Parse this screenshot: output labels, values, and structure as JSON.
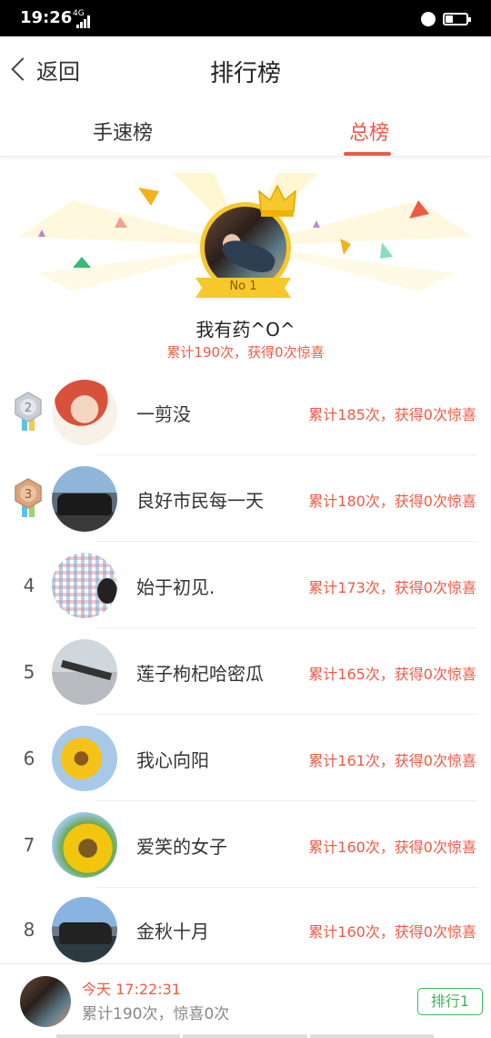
{
  "status_bar": {
    "time": "19:26",
    "network": "4G"
  },
  "header": {
    "back_label": "返回",
    "title": "排行榜"
  },
  "tabs": [
    {
      "label": "手速榜",
      "active": false
    },
    {
      "label": "总榜",
      "active": true
    }
  ],
  "champion": {
    "badge": "No 1",
    "name": "我有药^O^",
    "stats": "累计190次，获得0次惊喜"
  },
  "rankings": [
    {
      "rank": "2",
      "medal": "silver",
      "name": "一剪没",
      "stats": "累计185次，获得0次惊喜"
    },
    {
      "rank": "3",
      "medal": "bronze",
      "name": "良好市民每一天",
      "stats": "累计180次，获得0次惊喜"
    },
    {
      "rank": "4",
      "name": "始于初见.",
      "stats": "累计173次，获得0次惊喜"
    },
    {
      "rank": "5",
      "name": "莲子枸杞哈密瓜",
      "stats": "累计165次，获得0次惊喜"
    },
    {
      "rank": "6",
      "name": "我心向阳",
      "stats": "累计161次，获得0次惊喜"
    },
    {
      "rank": "7",
      "name": "爱笑的女子",
      "stats": "累计160次，获得0次惊喜"
    },
    {
      "rank": "8",
      "name": "金秋十月",
      "stats": "累计160次，获得0次惊喜"
    }
  ],
  "my_record": {
    "time": "今天 17:22:31",
    "summary": "累计190次，惊喜0次",
    "rank_button": "排行1"
  },
  "colors": {
    "accent": "#ee5a46",
    "gold": "#f6c82b",
    "green": "#3fb45b"
  }
}
